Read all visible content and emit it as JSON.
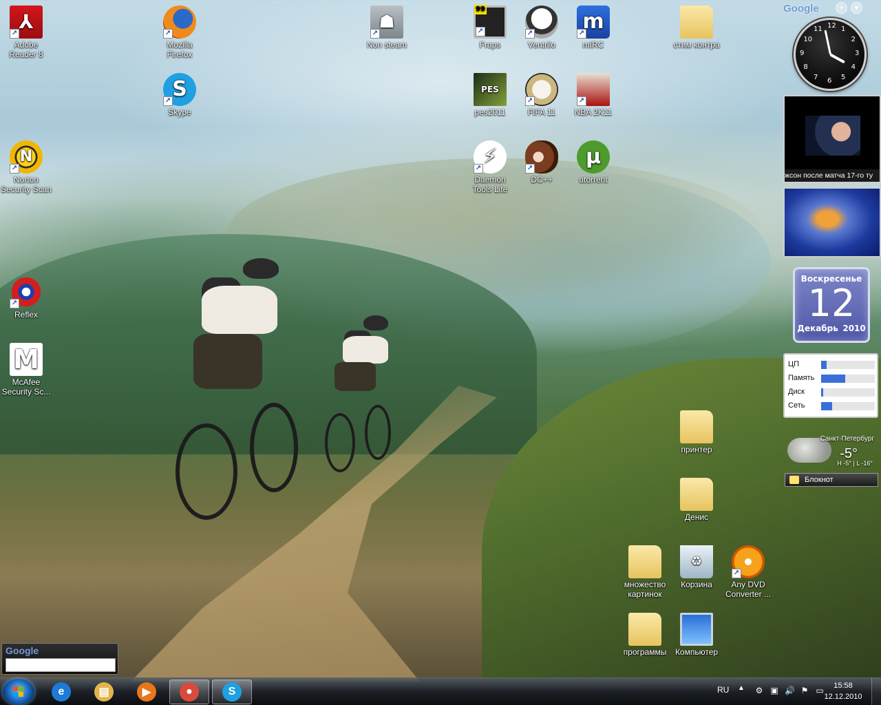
{
  "desktop": {
    "icons": [
      {
        "label": "Adobe Reader 8",
        "glyph": "⅄",
        "shortcut": true
      },
      {
        "label": "Mozilla Firefox",
        "glyph": "",
        "shortcut": true
      },
      {
        "label": "Skype",
        "glyph": "S",
        "shortcut": true
      },
      {
        "label": "Norton Security Scan",
        "glyph": "N",
        "shortcut": true
      },
      {
        "label": "Reflex",
        "glyph": "",
        "shortcut": true
      },
      {
        "label": "McAfee Security Sc...",
        "glyph": "M",
        "shortcut": false
      },
      {
        "label": "Non steam",
        "glyph": "☗",
        "shortcut": true
      },
      {
        "label": "Fraps",
        "glyph": "",
        "shortcut": true
      },
      {
        "label": "Ventrilo",
        "glyph": "",
        "shortcut": true
      },
      {
        "label": "mIRC",
        "glyph": "m",
        "shortcut": true
      },
      {
        "label": "стим контра",
        "glyph": "",
        "shortcut": false
      },
      {
        "label": "pes2011",
        "glyph": "PES",
        "shortcut": false
      },
      {
        "label": "FIFA 11",
        "glyph": "",
        "shortcut": true
      },
      {
        "label": "NBA 2K11",
        "glyph": "",
        "shortcut": true
      },
      {
        "label": "Daemon Tools Lite",
        "glyph": "⚡",
        "shortcut": true
      },
      {
        "label": "DC++",
        "glyph": "",
        "shortcut": true
      },
      {
        "label": "utorrent",
        "glyph": "µ",
        "shortcut": false
      },
      {
        "label": "принтер",
        "glyph": "",
        "shortcut": false
      },
      {
        "label": "Денис",
        "glyph": "",
        "shortcut": false
      },
      {
        "label": "множество картинок",
        "glyph": "",
        "shortcut": false
      },
      {
        "label": "Корзина",
        "glyph": "♻",
        "shortcut": false
      },
      {
        "label": "Any DVD Converter ...",
        "glyph": "",
        "shortcut": true
      },
      {
        "label": "программы",
        "glyph": "",
        "shortcut": false
      },
      {
        "label": "Компьютер",
        "glyph": "",
        "shortcut": false
      }
    ],
    "shortcut_glyph": "↗"
  },
  "gadgets": {
    "google_toolbar": {
      "logo": "Google",
      "add": "+",
      "menu": "▾"
    },
    "clock": {
      "numbers": [
        "12",
        "1",
        "2",
        "3",
        "4",
        "5",
        "6",
        "7",
        "8",
        "9",
        "10",
        "11"
      ],
      "time": "15:58"
    },
    "news": {
      "caption": "жсон после матча 17-го ту"
    },
    "calendar": {
      "weekday": "Воскресенье",
      "day": "12",
      "month": "Декабрь",
      "year": "2010"
    },
    "meter": {
      "rows": [
        {
          "label": "ЦП",
          "level": 0.1
        },
        {
          "label": "Память",
          "level": 0.45
        },
        {
          "label": "Диск",
          "level": 0.04
        },
        {
          "label": "Сеть",
          "level": 0.2
        }
      ]
    },
    "weather": {
      "city": "Санкт-Петербург",
      "temp": "-5°",
      "range": "H -5° | L -16°"
    },
    "notes": {
      "label": "Блокнот"
    },
    "google_search": {
      "logo": "Google",
      "placeholder": ""
    }
  },
  "taskbar": {
    "pinned": [
      {
        "name": "internet-explorer",
        "glyph": "e",
        "color": "#1e7ad6"
      },
      {
        "name": "explorer",
        "glyph": "▤",
        "color": "#e2b54a"
      },
      {
        "name": "media-player",
        "glyph": "▶",
        "color": "#e8761b"
      },
      {
        "name": "chrome",
        "glyph": "●",
        "color": "#d94a3a"
      },
      {
        "name": "skype",
        "glyph": "S",
        "color": "#1fa0e2"
      }
    ],
    "tray": {
      "language": "RU",
      "expand": "▲",
      "icons": [
        "⚙",
        "▣",
        "🔊",
        "⚑",
        "▭"
      ]
    },
    "clock": {
      "time": "15:58",
      "date": "12.12.2010"
    }
  },
  "colors": {
    "accent": "#1e6fc9",
    "calendar": "#5e67b6",
    "meter_fill": "#3a6fd8"
  }
}
